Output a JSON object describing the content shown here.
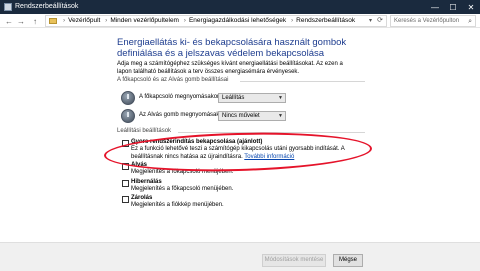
{
  "window": {
    "title": "Rendszerbeállítások",
    "minimize_glyph": "—",
    "maximize_glyph": "☐",
    "close_glyph": "✕"
  },
  "addressbar": {
    "back_glyph": "←",
    "forward_glyph": "→",
    "up_glyph": "↑",
    "separator": "›",
    "crumbs": [
      "Vezérlőpult",
      "Minden vezérlőpultelem",
      "Energiagazdálkodási lehetőségek",
      "Rendszerbeállítások"
    ],
    "search_placeholder": "Keresés a Vezérlőpulton"
  },
  "main": {
    "heading": "Energiaellátás ki- és bekapcsolására használt gombok definiálása és a jelszavas védelem bekapcsolása",
    "intro": "Adja meg a számítógéphez szükséges kívánt energiaellátási beállításokat. Az ezen a lapon található beállítások a terv összes energiasémára érvényesek.",
    "buttons_group_label": "A főkapcsoló és az Alvás gomb beállításai",
    "power_button_label": "A főkapcsoló megnyomásakor:",
    "power_button_value": "Leállítás",
    "sleep_button_label": "Az Alvás gomb megnyomásakor:",
    "sleep_button_value": "Nincs művelet",
    "shutdown_group_label": "Leállítási beállítások",
    "fast_startup_title": "Gyors rendszerindítás bekapcsolása (ajánlott)",
    "fast_startup_desc": "Ez a funkció lehetővé teszi a számítógép kikapcsolás utáni gyorsabb indítását. A beállításnak nincs hatása az újraindításra.",
    "fast_startup_link": "További információ",
    "sleep_title": "Alvás",
    "sleep_desc": "Megjelenítés a főkapcsoló menüjében.",
    "hibernate_title": "Hibernálás",
    "hibernate_desc": "Megjelenítés a főkapcsoló menüjében.",
    "lock_title": "Zárolás",
    "lock_desc": "Megjelenítés a fiókkép menüjében."
  },
  "footer": {
    "save_label": "Módosítások mentése",
    "cancel_label": "Mégse"
  },
  "colors": {
    "heading": "#1e3d8f",
    "annotation": "#e5132a",
    "link": "#0645ad",
    "titlebar": "#1a2a3e"
  },
  "icons": [
    "app-icon",
    "folder-icon",
    "power-button-icon",
    "sleep-button-icon",
    "search-icon",
    "refresh-icon"
  ]
}
